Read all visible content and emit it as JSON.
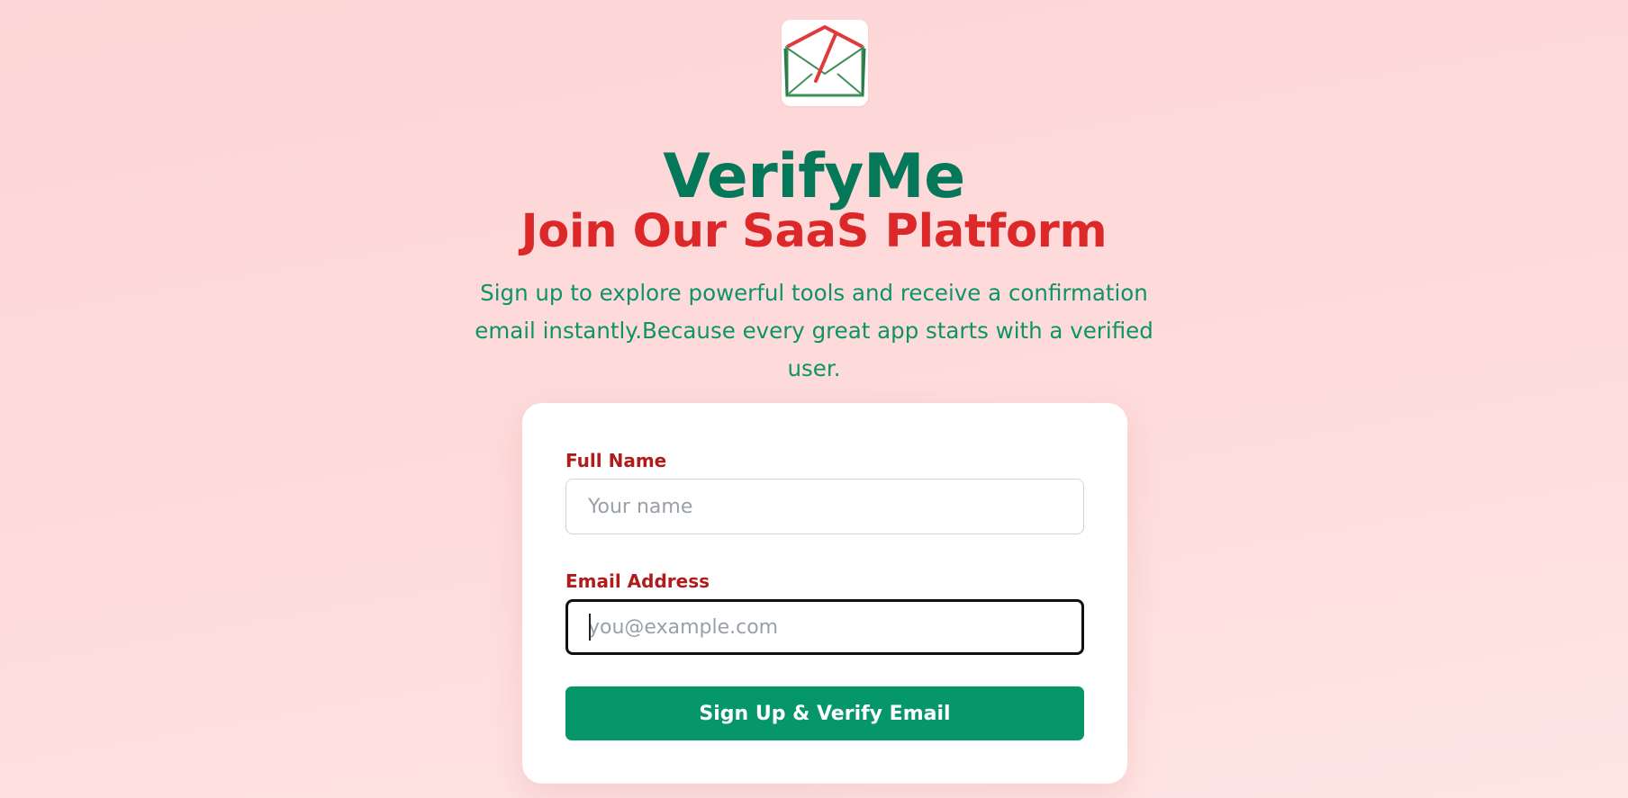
{
  "header": {
    "logo_icon": "envelope-check-icon",
    "brand": "VerifyMe",
    "headline": "Join Our SaaS Platform",
    "subtext": "Sign up to explore powerful tools and receive a confirmation email instantly.Because every great app starts with a verified user."
  },
  "form": {
    "name_label": "Full Name",
    "name_placeholder": "Your name",
    "name_value": "",
    "email_label": "Email Address",
    "email_placeholder": "you@example.com",
    "email_value": "",
    "submit_label": "Sign Up & Verify Email"
  },
  "colors": {
    "brand_green": "#05785a",
    "headline_red": "#dc2828",
    "label_red": "#b01c1c",
    "button_green": "#059669",
    "subtext_green": "#0d9466",
    "background_pink": "#fdd5d6"
  }
}
